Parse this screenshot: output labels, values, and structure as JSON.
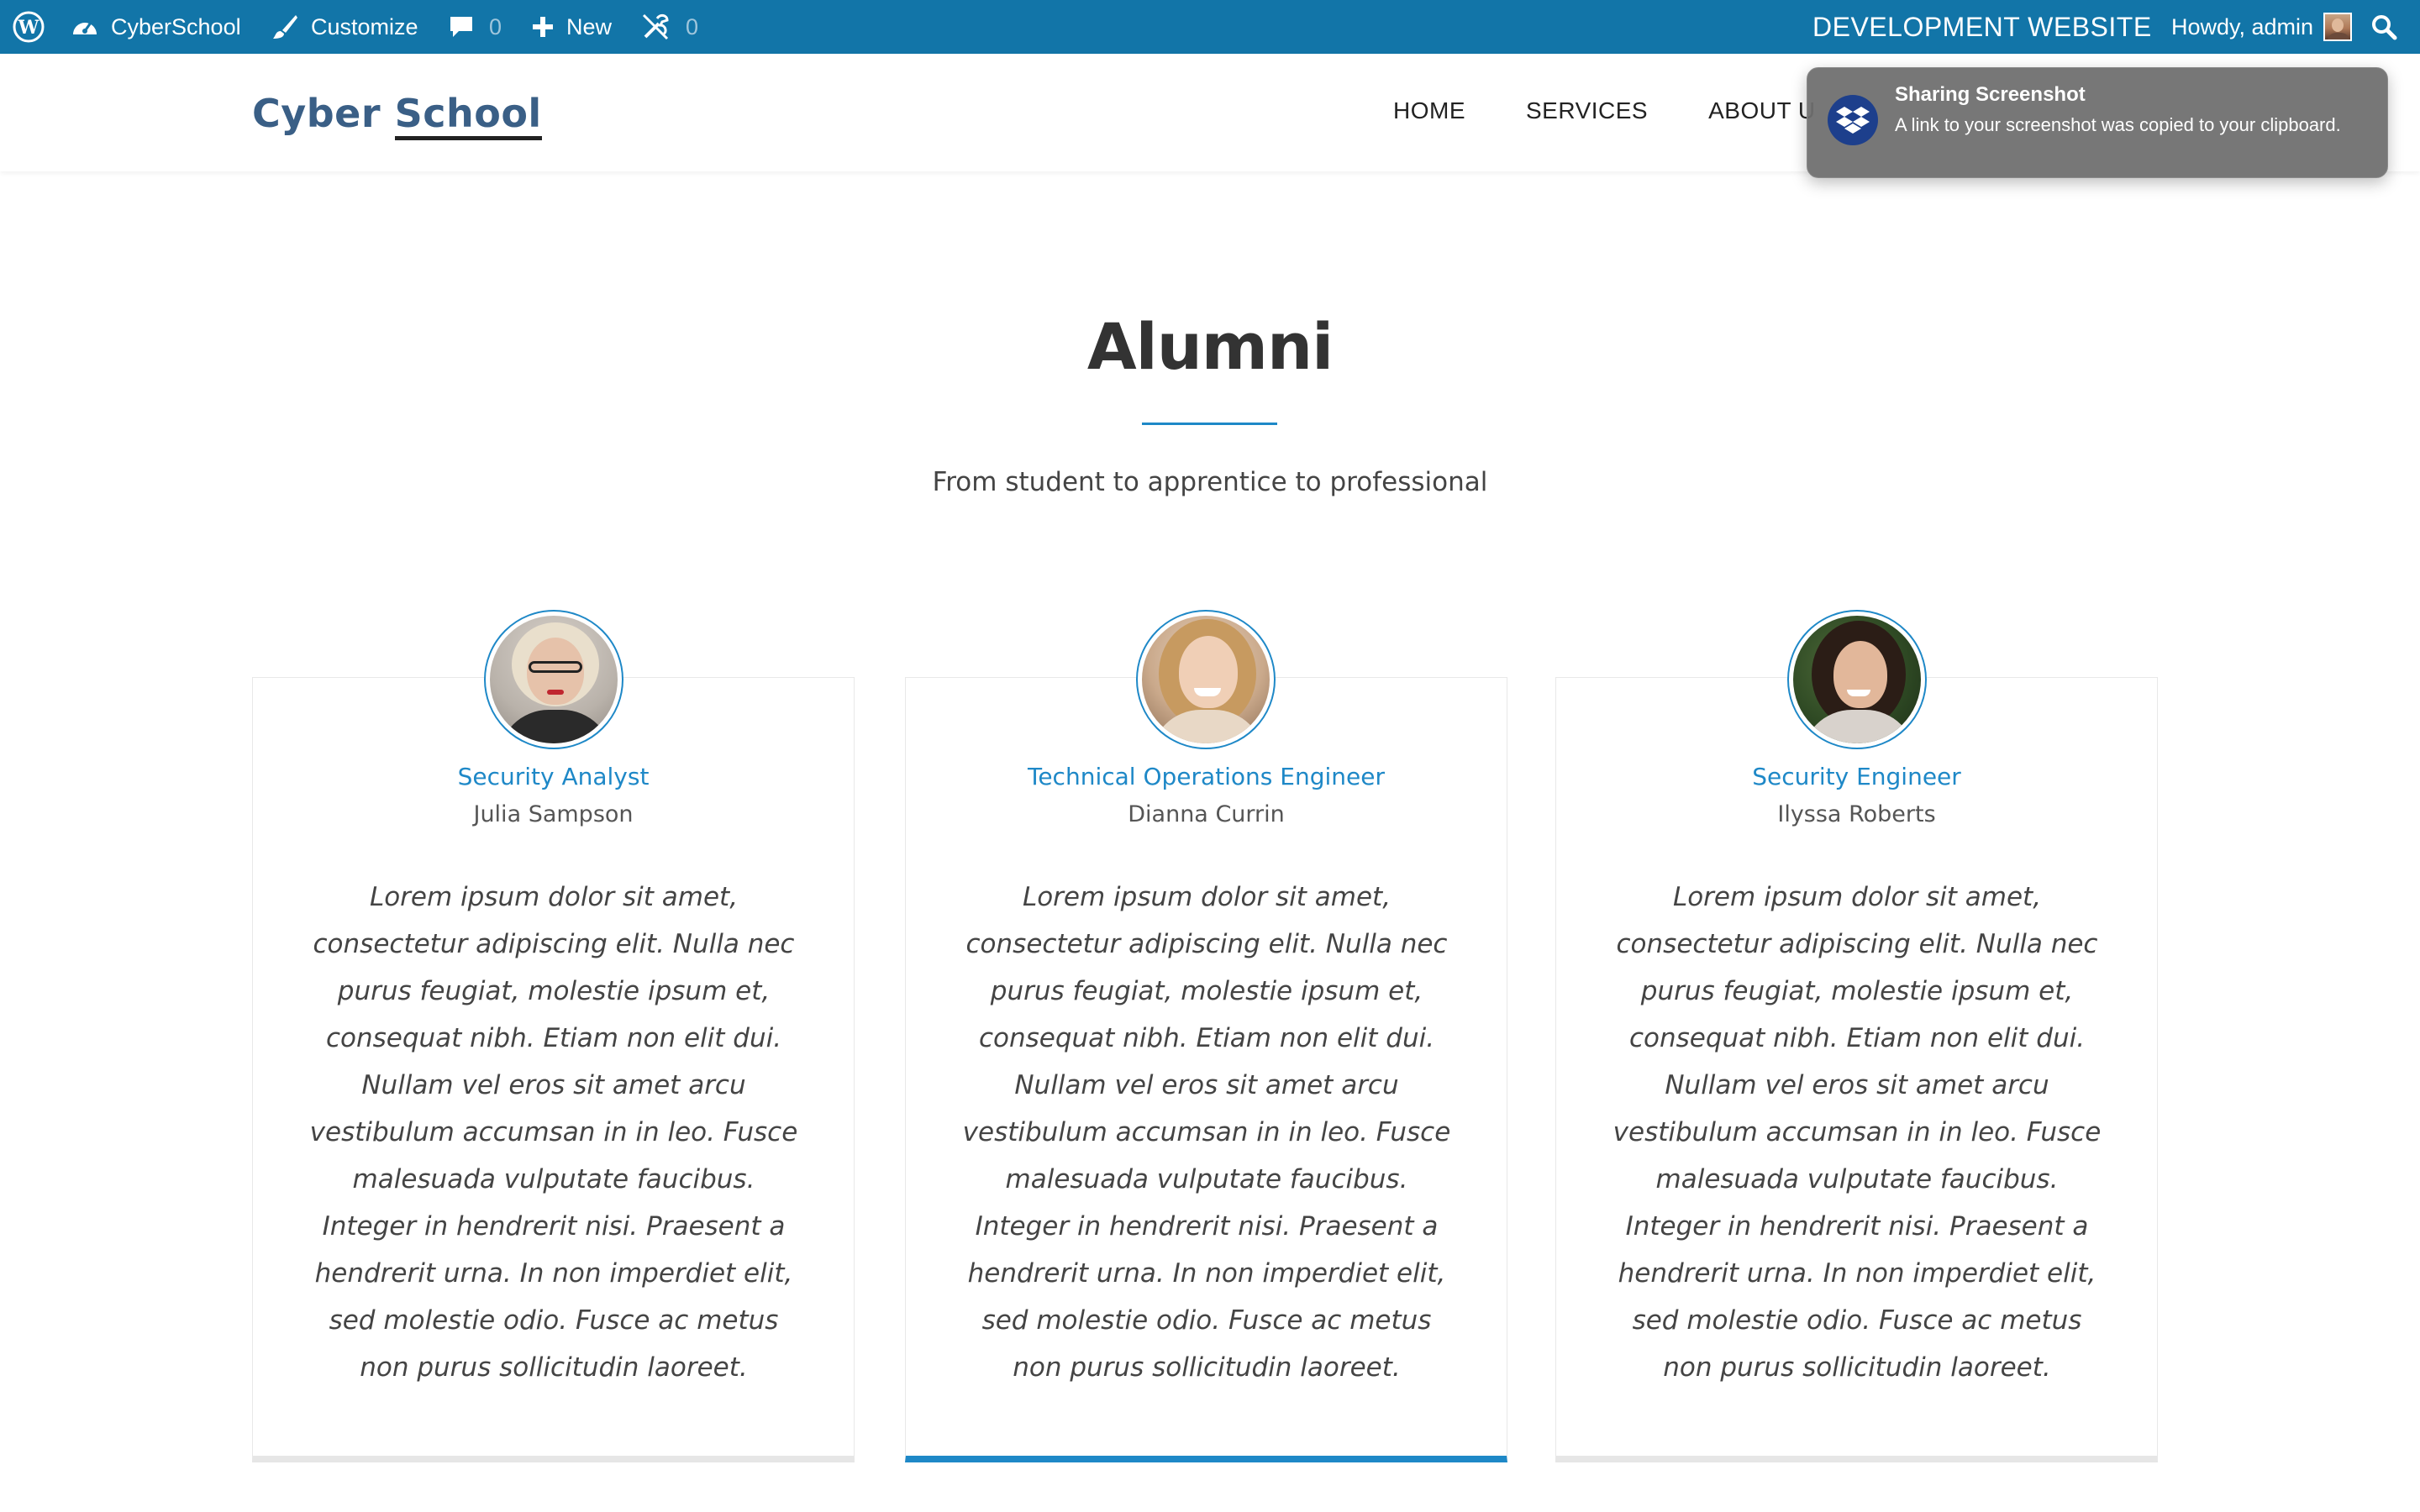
{
  "admin_bar": {
    "site_name": "CyberSchool",
    "customize": "Customize",
    "comments_count": "0",
    "new_label": "New",
    "tools_count": "0",
    "environment": "DEVELOPMENT WEBSITE",
    "howdy": "Howdy, admin"
  },
  "header": {
    "logo_part1": "Cyber",
    "logo_part2": "School",
    "nav": [
      "HOME",
      "SERVICES",
      "ABOUT U"
    ]
  },
  "notification": {
    "title": "Sharing Screenshot",
    "body": "A link to your screenshot was copied to your clipboard."
  },
  "alumni": {
    "title": "Alumni",
    "subtitle": "From student to apprentice to professional",
    "cards": [
      {
        "role": "Security Analyst",
        "name": "Julia Sampson",
        "quote": "Lorem ipsum dolor sit amet, consectetur adipiscing elit. Nulla nec purus feugiat, molestie ipsum et, consequat nibh. Etiam non elit dui. Nullam vel eros sit amet arcu vestibulum accumsan in in leo. Fusce malesuada vulputate faucibus. Integer in hendrerit nisi. Praesent a hendrerit urna. In non imperdiet elit, sed molestie odio. Fusce ac metus non purus sollicitudin laoreet."
      },
      {
        "role": "Technical Operations Engineer",
        "name": "Dianna Currin",
        "quote": "Lorem ipsum dolor sit amet, consectetur adipiscing elit. Nulla nec purus feugiat, molestie ipsum et, consequat nibh. Etiam non elit dui. Nullam vel eros sit amet arcu vestibulum accumsan in in leo. Fusce malesuada vulputate faucibus. Integer in hendrerit nisi. Praesent a hendrerit urna. In non imperdiet elit, sed molestie odio. Fusce ac metus non purus sollicitudin laoreet."
      },
      {
        "role": "Security Engineer",
        "name": "Ilyssa Roberts",
        "quote": "Lorem ipsum dolor sit amet, consectetur adipiscing elit. Nulla nec purus feugiat, molestie ipsum et, consequat nibh. Etiam non elit dui. Nullam vel eros sit amet arcu vestibulum accumsan in in leo. Fusce malesuada vulputate faucibus. Integer in hendrerit nisi. Praesent a hendrerit urna. In non imperdiet elit, sed molestie odio. Fusce ac metus non purus sollicitudin laoreet."
      }
    ]
  },
  "colors": {
    "admin_bar": "#1275a8",
    "accent": "#1e88c7",
    "logo": "#3a5f86",
    "notification_bg": "#6e6e6e",
    "dropbox_icon_bg": "#1d3f8c"
  },
  "icons": {
    "wordpress": "wordpress-icon",
    "dashboard": "dashboard-icon",
    "customize": "paintbrush-icon",
    "comments": "comment-bubble-icon",
    "new": "plus-icon",
    "tools": "no-tools-icon",
    "search": "search-icon",
    "dropbox": "dropbox-icon"
  }
}
